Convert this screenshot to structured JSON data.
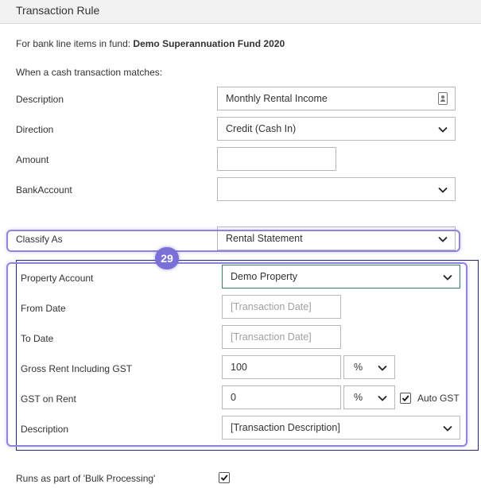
{
  "header": {
    "title": "Transaction Rule"
  },
  "intro": {
    "fund_prefix": "For bank line items in fund:",
    "fund_name": "Demo Superannuation Fund 2020",
    "match_text": "When a cash transaction matches:"
  },
  "match": {
    "description_label": "Description",
    "description_value": "Monthly Rental Income",
    "direction_label": "Direction",
    "direction_value": "Credit (Cash In)",
    "amount_label": "Amount",
    "amount_value": "",
    "bank_account_label": "BankAccount",
    "bank_account_value": ""
  },
  "classify": {
    "label": "Classify As",
    "value": "Rental Statement"
  },
  "annotation": {
    "badge": "29"
  },
  "rental": {
    "property_account_label": "Property Account",
    "property_account_value": "Demo Property",
    "from_date_label": "From Date",
    "from_date_placeholder": "[Transaction Date]",
    "to_date_label": "To Date",
    "to_date_placeholder": "[Transaction Date]",
    "gross_rent_label": "Gross Rent Including GST",
    "gross_rent_value": "100",
    "gross_rent_unit": "%",
    "gst_label": "GST on Rent",
    "gst_value": "0",
    "gst_unit": "%",
    "auto_gst_label": "Auto GST",
    "auto_gst_checked": true,
    "description_label": "Description",
    "description_value": "[Transaction Description]"
  },
  "bulk": {
    "label": "Runs as part of 'Bulk Processing'",
    "checked": true
  }
}
